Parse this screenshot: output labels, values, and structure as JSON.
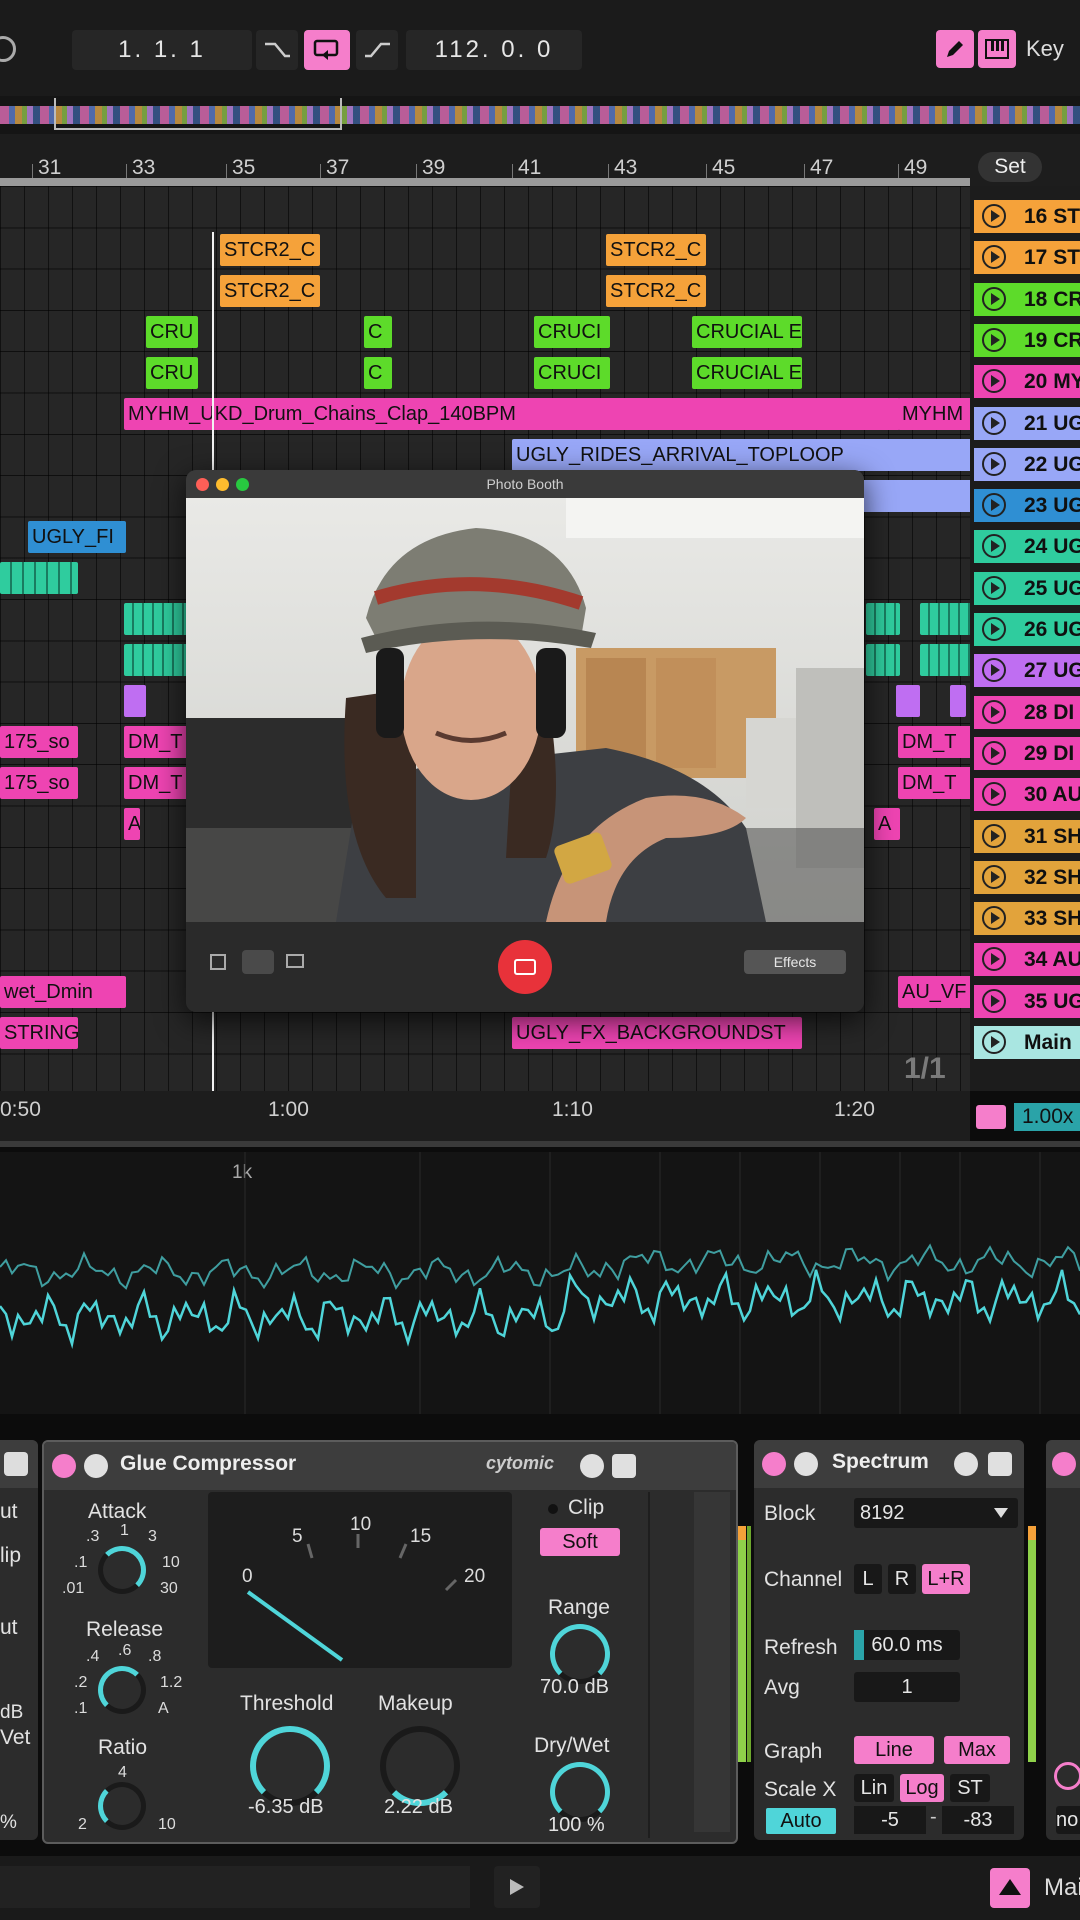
{
  "transport": {
    "position": "1.  1.  1",
    "tempo": "112.  0.  0",
    "key_label": "Key"
  },
  "arrangement": {
    "bar_numbers": [
      "31",
      "33",
      "35",
      "37",
      "39",
      "41",
      "43",
      "45",
      "47",
      "49"
    ],
    "set_label": "Set",
    "clips": {
      "stcr2": "STCR2_C",
      "crucial": "CRUCIAL E",
      "cru_short": "CRU",
      "cruci": "CRUCI",
      "c": "C",
      "myhm": "MYHM_UKD_Drum_Chains_Clap_140BPM",
      "myhm_short": "MYHM",
      "ugly_rides": "UGLY_RIDES_ARRIVAL_TOPLOOP",
      "ugly_fi": "UGLY_FI",
      "so175": "175_so",
      "dm_t": "DM_T",
      "a": "A",
      "wet_dmin": "wet_Dmin",
      "au_vf": "AU_VF",
      "string": "STRING",
      "ugly_fx": "UGLY_FX_BACKGROUNDST"
    },
    "loop_counter": "1/1"
  },
  "scenes": [
    {
      "label": "16 ST",
      "color": "#f5a23a"
    },
    {
      "label": "17 ST",
      "color": "#f5a23a"
    },
    {
      "label": "18 CR",
      "color": "#5ddb2a"
    },
    {
      "label": "19 CR",
      "color": "#5ddb2a"
    },
    {
      "label": "20 MY",
      "color": "#ee44b2"
    },
    {
      "label": "21 UG",
      "color": "#98a7f7"
    },
    {
      "label": "22 UG",
      "color": "#98a7f7"
    },
    {
      "label": "23 UG",
      "color": "#2f8fd3"
    },
    {
      "label": "24 UG",
      "color": "#2fcc9e"
    },
    {
      "label": "25 UG",
      "color": "#2fcc9e"
    },
    {
      "label": "26 UG",
      "color": "#2fcc9e"
    },
    {
      "label": "27 UG",
      "color": "#bf6ef2"
    },
    {
      "label": "28 DI",
      "color": "#ee44b2"
    },
    {
      "label": "29 DI",
      "color": "#ee44b2"
    },
    {
      "label": "30 AU",
      "color": "#ee44b2"
    },
    {
      "label": "31 SH",
      "color": "#e2a33b"
    },
    {
      "label": "32 SH",
      "color": "#e2a33b"
    },
    {
      "label": "33 SH",
      "color": "#e2a33b"
    },
    {
      "label": "34 AU",
      "color": "#ee44b2"
    },
    {
      "label": "35 UG",
      "color": "#ee44b2"
    },
    {
      "label": "Main",
      "color": "#a9e6e1"
    }
  ],
  "time_ruler": [
    "0:50",
    "1:00",
    "1:10",
    "1:20"
  ],
  "zoom_value": "1.00x",
  "spectrum_display": {
    "freq_label": "1k"
  },
  "photo_booth": {
    "title": "Photo Booth",
    "effects_label": "Effects"
  },
  "glue_compressor": {
    "title": "Glue Compressor",
    "brand": "cytomic",
    "attack_label": "Attack",
    "attack_scale": [
      ".3",
      "1",
      "3",
      ".1",
      "10",
      ".01",
      "30"
    ],
    "release_label": "Release",
    "release_scale": [
      ".4",
      ".6",
      ".8",
      ".2",
      "1.2",
      ".1",
      "A"
    ],
    "ratio_label": "Ratio",
    "ratio_scale": [
      "4",
      "2",
      "10"
    ],
    "meter_scale": [
      "0",
      "5",
      "10",
      "15",
      "20"
    ],
    "threshold_label": "Threshold",
    "threshold_value": "-6.35 dB",
    "makeup_label": "Makeup",
    "makeup_value": "2.22 dB",
    "clip_label": "Clip",
    "soft_label": "Soft",
    "range_label": "Range",
    "range_value": "70.0 dB",
    "drywet_label": "Dry/Wet",
    "drywet_value": "100 %"
  },
  "left_device_partial": {
    "labels": [
      "ut",
      "lip",
      "ut",
      "dB",
      "Vet",
      "%"
    ]
  },
  "spectrum_device": {
    "title": "Spectrum",
    "block_label": "Block",
    "block_value": "8192",
    "channel_label": "Channel",
    "channel_options": [
      "L",
      "R",
      "L+R"
    ],
    "refresh_label": "Refresh",
    "refresh_value": "60.0 ms",
    "avg_label": "Avg",
    "avg_value": "1",
    "graph_label": "Graph",
    "graph_options": [
      "Line",
      "Max"
    ],
    "scale_x_label": "Scale X",
    "scale_x_options": [
      "Lin",
      "Log",
      "ST"
    ],
    "auto_label": "Auto",
    "range_low": "-5",
    "range_dash": "-",
    "range_high": "-83"
  },
  "right_partial": {
    "label": "no"
  },
  "bottom_bar": {
    "main_label": "Mai"
  },
  "colors": {
    "accent_pink": "#f57ecb",
    "cyan": "#4fd5d9",
    "record_red": "#e8323a"
  }
}
